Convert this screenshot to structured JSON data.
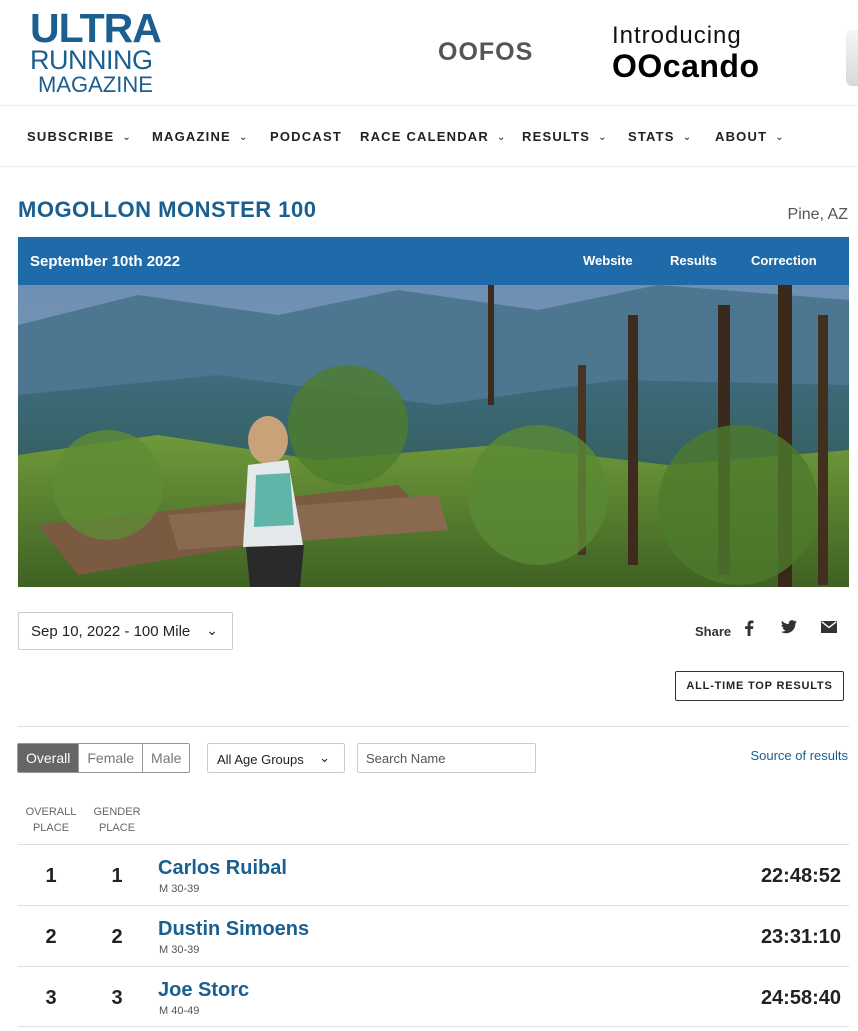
{
  "header": {
    "logo_line1": "ULTRA",
    "logo_line2": "RUNNING",
    "logo_line3": "MAGAZINE",
    "ad_brand": "OOFOS",
    "ad_intro": "Introducing",
    "ad_product": "OOcando"
  },
  "nav": [
    {
      "label": "SUBSCRIBE",
      "has_dropdown": true
    },
    {
      "label": "MAGAZINE",
      "has_dropdown": true
    },
    {
      "label": "PODCAST",
      "has_dropdown": false
    },
    {
      "label": "RACE CALENDAR",
      "has_dropdown": true
    },
    {
      "label": "RESULTS",
      "has_dropdown": true
    },
    {
      "label": "STATS",
      "has_dropdown": true
    },
    {
      "label": "ABOUT",
      "has_dropdown": true
    }
  ],
  "race": {
    "title": "MOGOLLON MONSTER 100",
    "location": "Pine, AZ",
    "date": "September 10th 2022",
    "links": [
      "Website",
      "Results",
      "Correction"
    ]
  },
  "controls": {
    "distance": "Sep 10, 2022 - 100 Mile",
    "share_label": "Share",
    "alltime_label": "ALL-TIME TOP RESULTS",
    "gender_tabs": [
      "Overall",
      "Female",
      "Male"
    ],
    "active_tab": "Overall",
    "age_group": "All Age Groups",
    "search_placeholder": "Search Name",
    "source_label": "Source of results"
  },
  "table": {
    "col_overall": [
      "OVERALL",
      "PLACE"
    ],
    "col_gender": [
      "GENDER",
      "PLACE"
    ],
    "rows": [
      {
        "overall": "1",
        "gender": "1",
        "name": "Carlos Ruibal",
        "category": "M 30-39",
        "time": "22:48:52"
      },
      {
        "overall": "2",
        "gender": "2",
        "name": "Dustin Simoens",
        "category": "M 30-39",
        "time": "23:31:10"
      },
      {
        "overall": "3",
        "gender": "3",
        "name": "Joe Storc",
        "category": "M 40-49",
        "time": "24:58:40"
      }
    ]
  },
  "colors": {
    "brand_blue": "#1a5f8f",
    "date_bar": "#1f6aa8"
  }
}
